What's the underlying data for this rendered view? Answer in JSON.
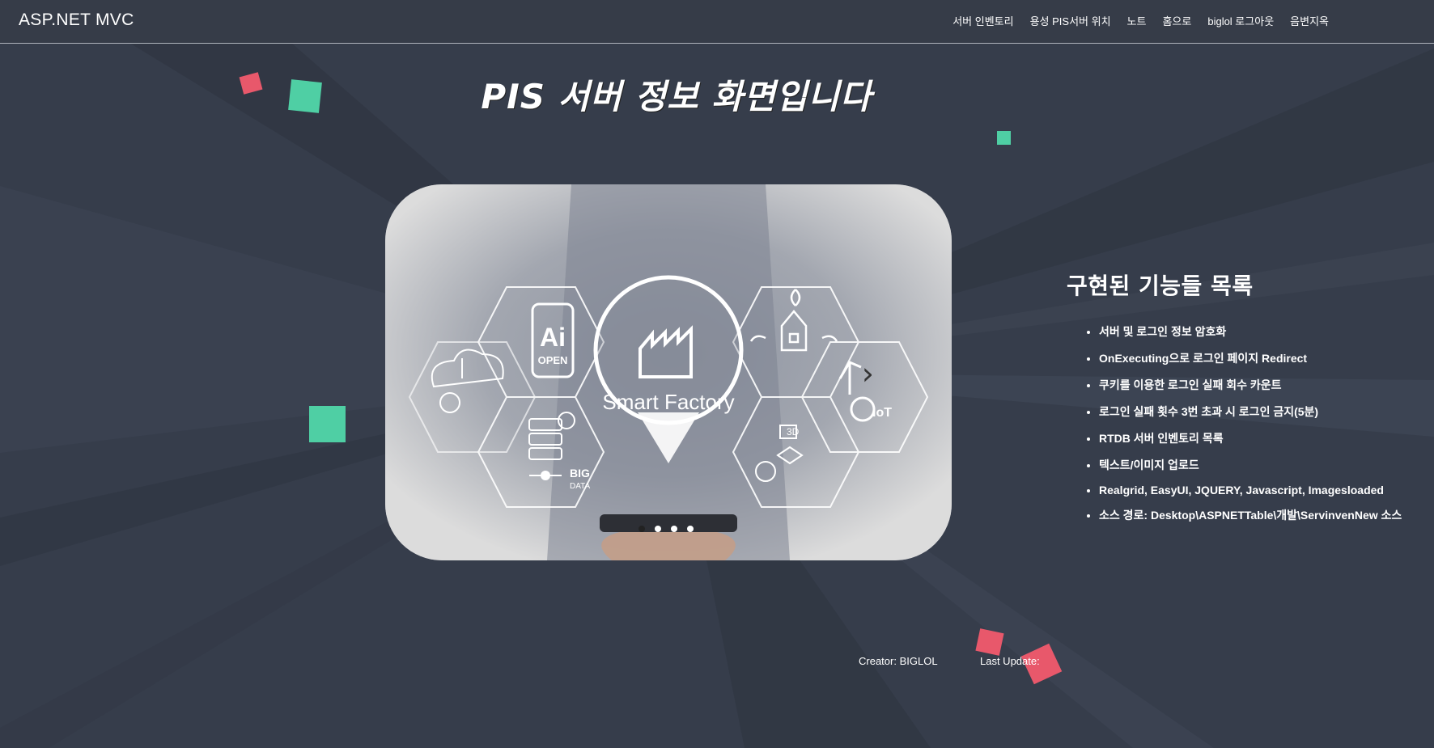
{
  "navbar": {
    "brand": "ASP.NET MVC",
    "links": [
      "서버 인벤토리",
      "용성 PIS서버 위치",
      "노트",
      "홈으로",
      "biglol 로그아웃",
      "음변지옥"
    ]
  },
  "page_title": "PIS 서버 정보 화면입니다",
  "carousel": {
    "center_label": "Smart Factory",
    "icon_labels": [
      "Ai",
      "OPEN",
      "BIG",
      "DATA",
      "3D",
      "IoT"
    ],
    "slide_count": 4,
    "active_index": 0,
    "next_icon": "chevron-right-icon"
  },
  "features": {
    "heading": "구현된 기능들 목록",
    "items": [
      "서버 및 로그인 정보 암호화",
      "OnExecuting으로 로그인 페이지 Redirect",
      "쿠키를 이용한 로그인 실패 회수 카운트",
      "로그인 실패 횟수 3번 초과 시 로그인 금지(5분)",
      "RTDB 서버 인벤토리 목록",
      "텍스트/이미지 업로드",
      "Realgrid, EasyUI, JQUERY, Javascript, Imagesloaded",
      "소스 경로: Desktop\\ASPNETTable\\개발\\ServinvenNew 소스"
    ]
  },
  "footer": {
    "creator_label": "Creator:",
    "creator_value": "BIGLOL",
    "last_update_label": "Last Update:"
  },
  "colors": {
    "background": "#363d4b",
    "accent_green": "#4fcfa4",
    "accent_red": "#e8586b"
  }
}
